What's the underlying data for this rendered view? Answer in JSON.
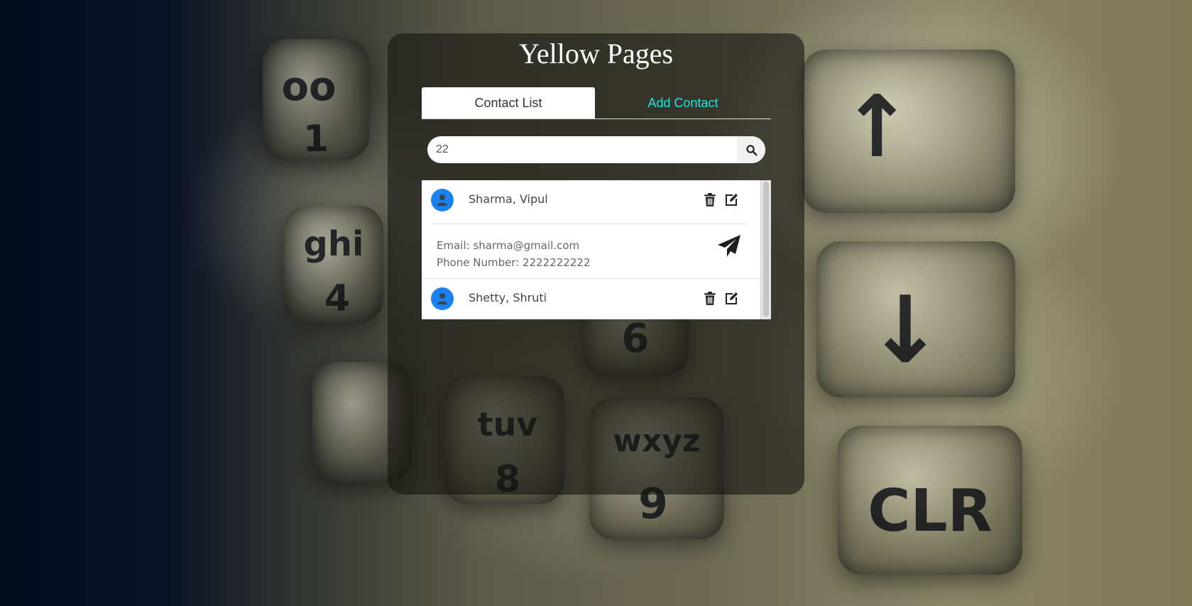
{
  "app": {
    "title": "Yellow Pages"
  },
  "tabs": [
    {
      "label": "Contact List",
      "active": true
    },
    {
      "label": "Add Contact",
      "active": false
    }
  ],
  "search": {
    "value": "22",
    "icon": "search-icon"
  },
  "contacts": [
    {
      "name": "Sharma,  Vipul",
      "expanded": true,
      "email_line": "Email: sharma@gmail.com",
      "phone_line": "Phone Number: 2222222222"
    },
    {
      "name": "Shetty,  Shruti",
      "expanded": false
    }
  ],
  "colors": {
    "tab_inactive_text": "#19e6e6",
    "avatar": "#1a82f0",
    "panel_overlay": "rgba(22,22,18,0.62)"
  },
  "icons": {
    "avatar": "user-icon",
    "delete": "trash-icon",
    "edit": "edit-icon",
    "send": "paper-plane-icon"
  }
}
